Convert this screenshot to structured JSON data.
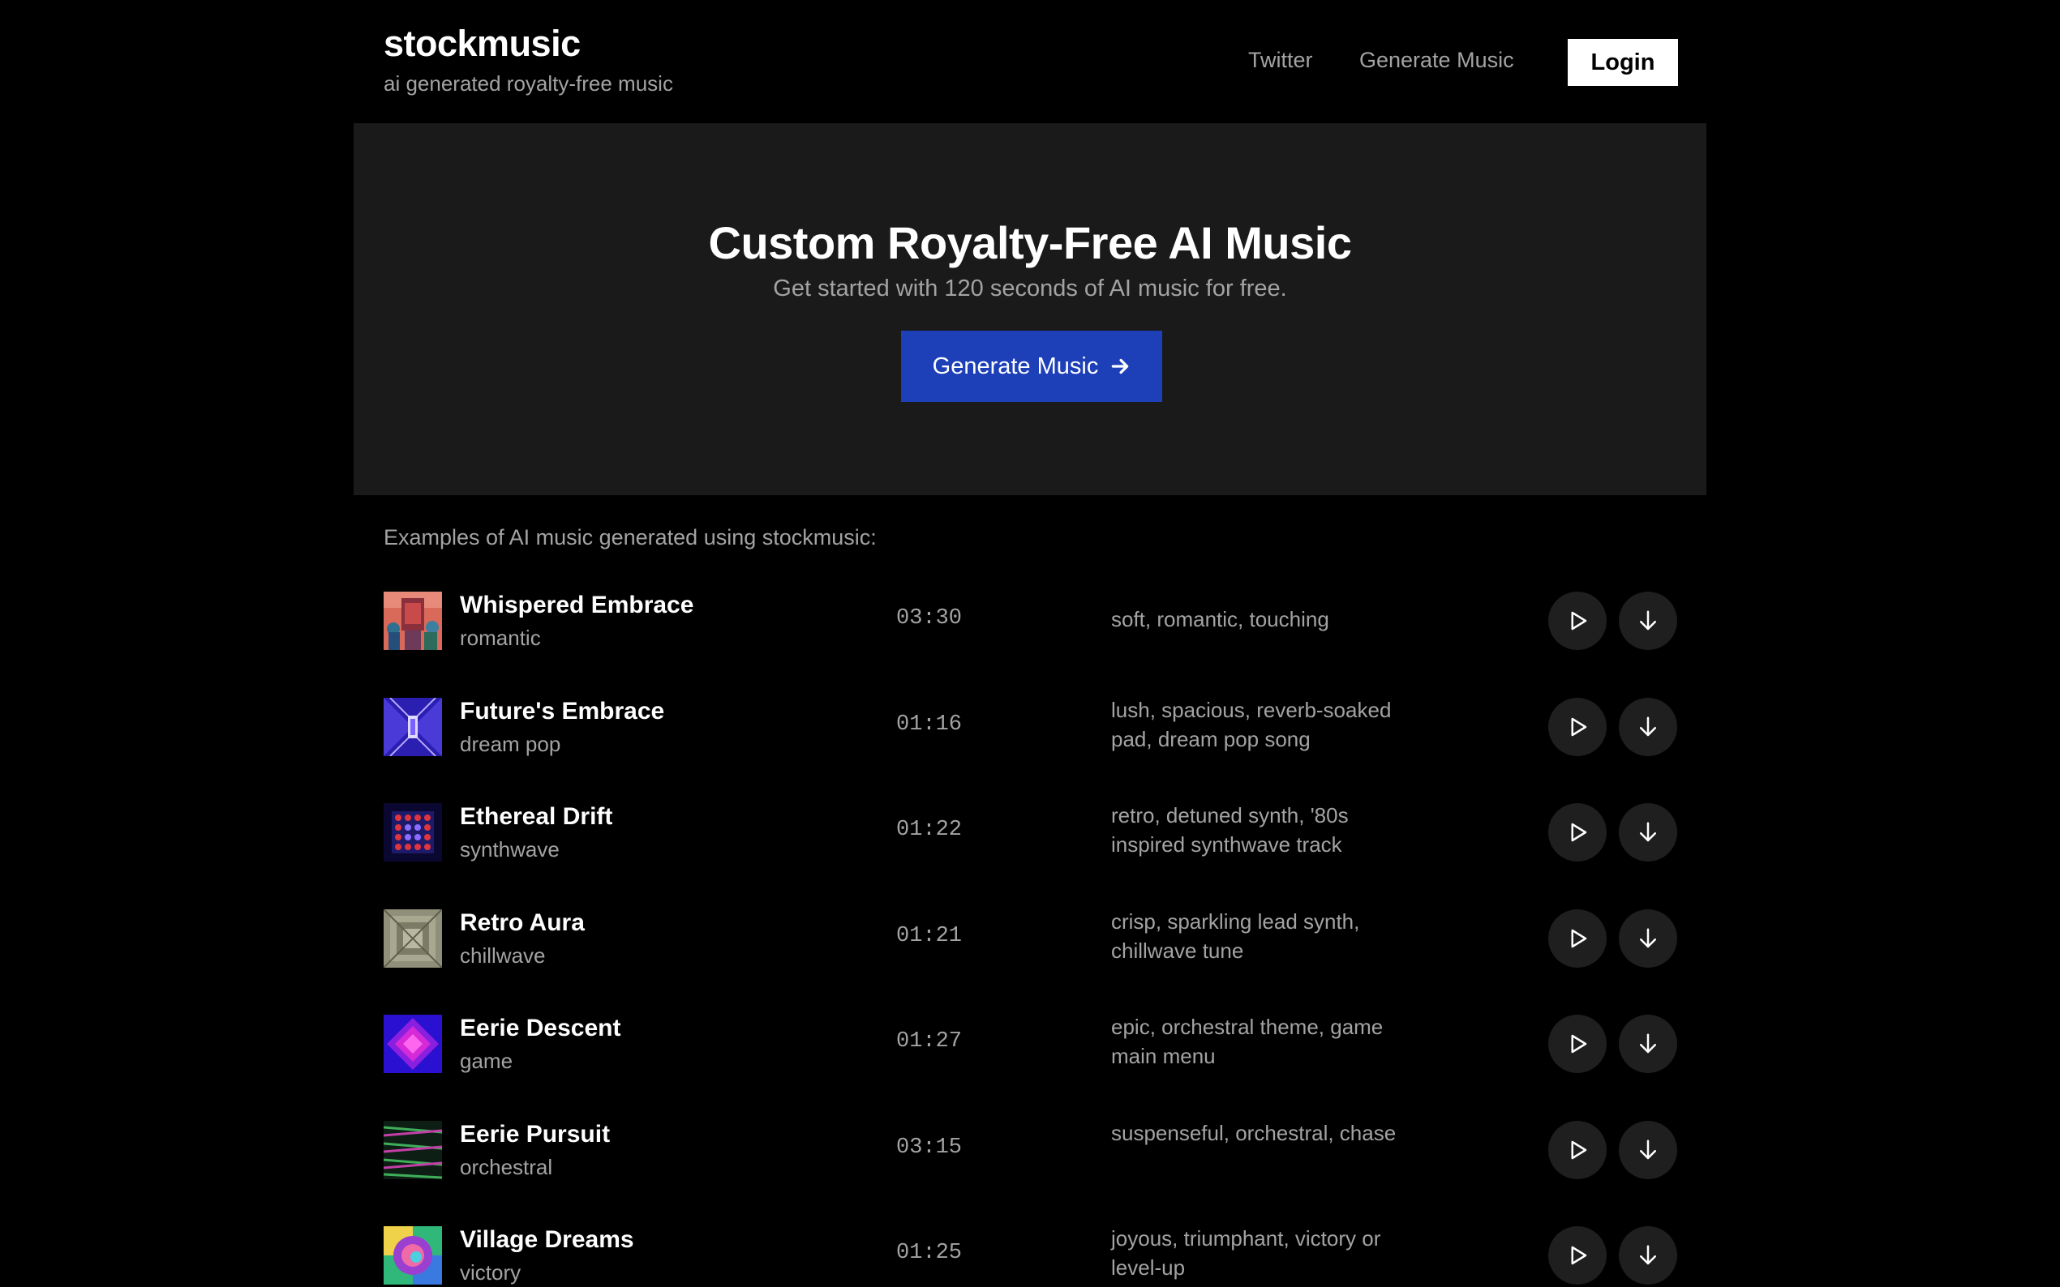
{
  "header": {
    "brand": "stockmusic",
    "tagline": "ai generated royalty-free music",
    "nav": {
      "twitter": "Twitter",
      "generate": "Generate Music"
    },
    "login_label": "Login"
  },
  "hero": {
    "title": "Custom Royalty-Free AI Music",
    "subtitle": "Get started with 120 seconds of AI music for free.",
    "cta_label": "Generate Music",
    "cta_color": "#1d3fb8"
  },
  "examples_label": "Examples of AI music generated using stockmusic:",
  "tracks": [
    {
      "title": "Whispered Embrace",
      "genre": "romantic",
      "duration": "03:30",
      "description": "soft, romantic, touching"
    },
    {
      "title": "Future's Embrace",
      "genre": "dream pop",
      "duration": "01:16",
      "description": "lush, spacious, reverb-soaked pad, dream pop song"
    },
    {
      "title": "Ethereal Drift",
      "genre": "synthwave",
      "duration": "01:22",
      "description": "retro, detuned synth, '80s inspired synthwave track"
    },
    {
      "title": "Retro Aura",
      "genre": "chillwave",
      "duration": "01:21",
      "description": "crisp, sparkling lead synth, chillwave tune"
    },
    {
      "title": "Eerie Descent",
      "genre": "game",
      "duration": "01:27",
      "description": "epic, orchestral theme, game main menu"
    },
    {
      "title": "Eerie Pursuit",
      "genre": "orchestral",
      "duration": "03:15",
      "description": "suspenseful, orchestral, chase"
    },
    {
      "title": "Village Dreams",
      "genre": "victory",
      "duration": "01:25",
      "description": "joyous, triumphant, victory or level-up"
    }
  ],
  "icons": {
    "play": "play-icon",
    "download": "download-icon",
    "cta_arrow": "arrow-right-icon"
  }
}
